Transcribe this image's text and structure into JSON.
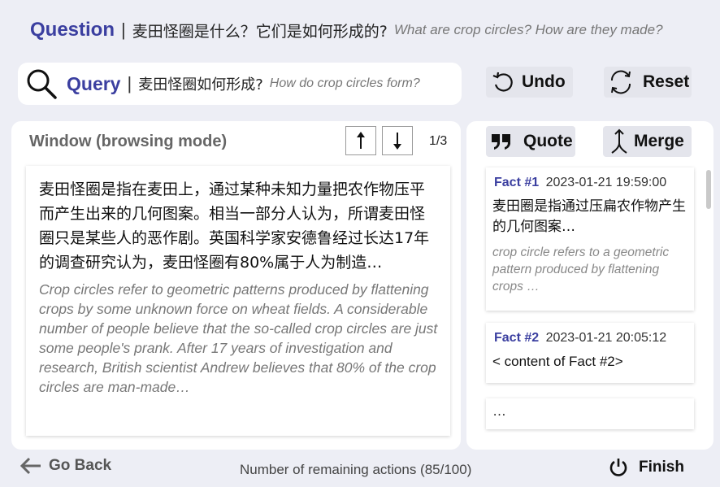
{
  "question": {
    "label": "Question",
    "separator": "|",
    "text_zh": "麦田怪圈是什么？它们是如何形成的?",
    "text_en": "What are crop circles? How are they made?"
  },
  "query": {
    "label": "Query",
    "separator": "|",
    "text_zh": "麦田怪圈如何形成?",
    "text_en": "How do crop circles form?",
    "icon": "search-icon"
  },
  "toolbar": {
    "undo_label": "Undo",
    "reset_label": "Reset"
  },
  "window": {
    "title": "Window (browsing mode)",
    "page_indicator": "1/3",
    "content_zh": "麦田怪圈是指在麦田上，通过某种未知力量把农作物压平而产生出来的几何图案。相当一部分人认为，所谓麦田怪圈只是某些人的恶作剧。英国科学家安德鲁经过长达17年的调查研究认为，麦田怪圈有80%属于人为制造…",
    "content_en": "Crop circles refer to geometric patterns produced by flattening crops by some unknown force on wheat fields. A considerable number of people believe that the so-called crop circles are just some people's prank. After 17 years of investigation and research, British scientist Andrew believes that 80% of the crop circles are man-made…"
  },
  "facts_panel": {
    "quote_label": "Quote",
    "merge_label": "Merge",
    "facts": [
      {
        "number": "Fact #1",
        "timestamp": "2023-01-21 19:59:00",
        "content_zh": "麦田圈是指通过压扁农作物产生的几何图案…",
        "content_en": "crop circle refers to a geometric pattern produced by flattening crops …"
      },
      {
        "number": "Fact #2",
        "timestamp": "2023-01-21 20:05:12",
        "content": "< content of Fact #2>"
      },
      {
        "content": "…"
      }
    ]
  },
  "footer": {
    "go_back_label": "Go Back",
    "remaining_actions": "Number of remaining actions (85/100)",
    "finish_label": "Finish"
  }
}
